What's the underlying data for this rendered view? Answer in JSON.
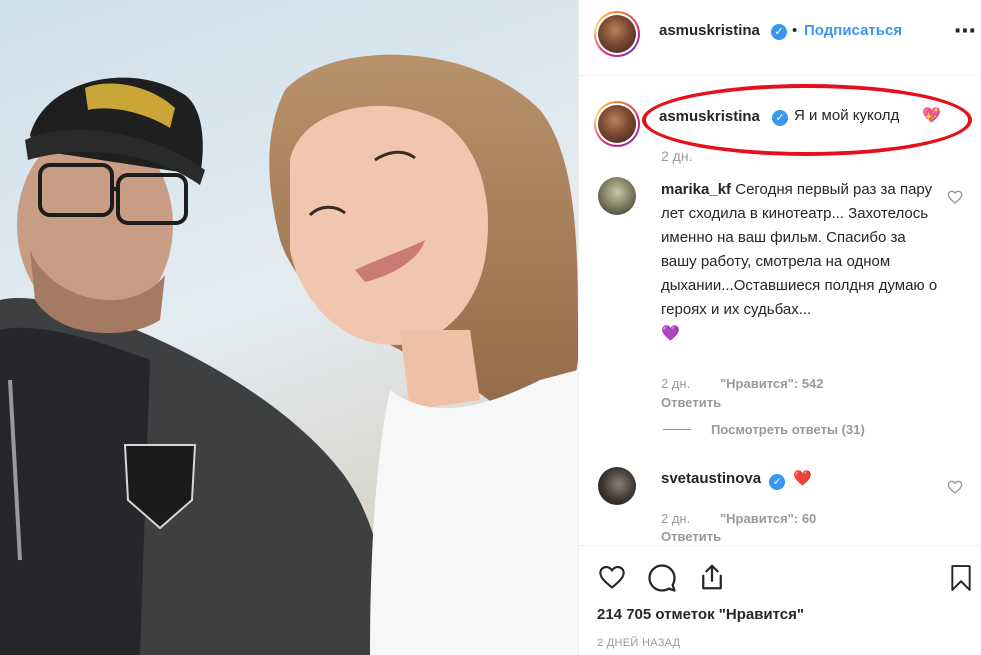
{
  "post": {
    "author": "asmuskristina",
    "follow_label": "Подписаться",
    "separator": "•",
    "more_label": "•••"
  },
  "caption": {
    "author": "asmuskristina",
    "text": "Я и мой куколд",
    "emoji": "💖",
    "age": "2 дн."
  },
  "comments": [
    {
      "author": "marika_kf",
      "text": "Сегодня первый раз за пару лет сходила в кинотеатр... Захотелось именно на ваш фильм. Спасибо за вашу работу, смотрела на одном дыхании...Оставшиеся полдня думаю о героях и их судьбах...",
      "emoji": "💜",
      "age": "2 дн.",
      "likes_label": "\"Нравится\": 542",
      "reply_label": "Ответить",
      "view_replies": "Посмотреть ответы (31)"
    },
    {
      "author": "svetaustinova",
      "text": "",
      "emoji": "❤️",
      "age": "2 дн.",
      "likes_label": "\"Нравится\": 60",
      "reply_label": "Ответить"
    }
  ],
  "footer": {
    "likes": "214 705 отметок \"Нравится\"",
    "posted": "2 ДНЕЙ НАЗАД"
  },
  "icons": {
    "like": "heart-icon",
    "comment": "comment-icon",
    "share": "share-icon",
    "save": "bookmark-icon",
    "verified": "verified-badge-icon"
  },
  "colors": {
    "link": "#3897f0",
    "meta": "#999999",
    "highlight": "#e5101c"
  }
}
